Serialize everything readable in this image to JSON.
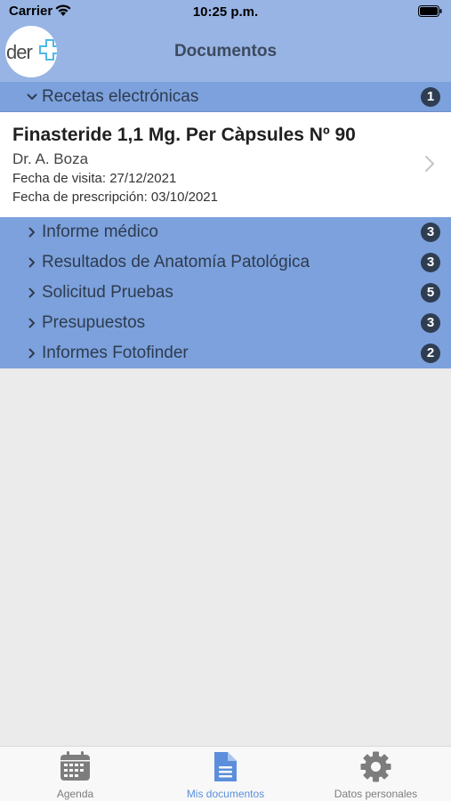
{
  "status_bar": {
    "carrier": "Carrier",
    "time": "10:25 p.m."
  },
  "header": {
    "logo_text": "der",
    "title": "Documentos"
  },
  "sections": [
    {
      "label": "Recetas electrónicas",
      "count": "1",
      "expanded": true
    },
    {
      "label": "Informe médico",
      "count": "3",
      "expanded": false
    },
    {
      "label": "Resultados de Anatomía Patológica",
      "count": "3",
      "expanded": false
    },
    {
      "label": "Solicitud Pruebas",
      "count": "5",
      "expanded": false
    },
    {
      "label": "Presupuestos",
      "count": "3",
      "expanded": false
    },
    {
      "label": "Informes Fotofinder",
      "count": "2",
      "expanded": false
    }
  ],
  "prescription": {
    "title": "Finasteride 1,1 Mg. Per Càpsules Nº 90",
    "doctor": "Dr. A. Boza",
    "visit_date": "Fecha de visita: 27/12/2021",
    "prescription_date": "Fecha de prescripción: 03/10/2021"
  },
  "tabs": [
    {
      "label": "Agenda",
      "icon": "calendar-icon",
      "active": false
    },
    {
      "label": "Mis documentos",
      "icon": "document-icon",
      "active": true
    },
    {
      "label": "Datos personales",
      "icon": "gear-icon",
      "active": false
    }
  ],
  "colors": {
    "header_bg": "#98b4e4",
    "section_bg": "#7ca1dc",
    "badge_bg": "#2f3d52",
    "active_tab": "#5b8fdc",
    "inactive_tab": "#7d7d7d",
    "logo_accent": "#4db8e8"
  }
}
